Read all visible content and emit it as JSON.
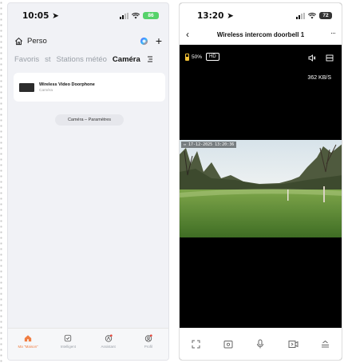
{
  "left_phone": {
    "status": {
      "time": "10:05",
      "battery": "86"
    },
    "header": {
      "home_label": "Perso"
    },
    "tabs": [
      {
        "label": "Favoris",
        "active": false
      },
      {
        "label": "st",
        "active": false
      },
      {
        "label": "Stations météo",
        "active": false
      },
      {
        "label": "Caméra",
        "active": true
      }
    ],
    "device_card": {
      "name": "Wireless Video Doorphone",
      "subtitle": "Caméra"
    },
    "settings_button": "Caméra – Paramètres",
    "bottom_nav": [
      {
        "label": "Ma \"Maison\"",
        "icon": "house-icon",
        "active": true
      },
      {
        "label": "Intelligent",
        "icon": "checkbox-icon",
        "active": false
      },
      {
        "label": "Assistant",
        "icon": "assistant-icon",
        "active": false
      },
      {
        "label": "Profil",
        "icon": "profile-icon",
        "active": false
      }
    ],
    "colors": {
      "accent": "#f07d42",
      "battery": "#55d26a"
    }
  },
  "right_phone": {
    "status": {
      "time": "13:20",
      "battery": "72"
    },
    "title": "Wireless intercom doorbell 1",
    "camera_battery": "50%",
    "quality": "HD",
    "speed": "362 KB/S",
    "osd_timestamp": "17-12-2025  13:20:36",
    "controls": [
      "fullscreen-icon",
      "screenshot-icon",
      "microphone-icon",
      "record-icon",
      "menu-icon"
    ],
    "colors": {
      "camera_battery": "#f3c237"
    }
  }
}
